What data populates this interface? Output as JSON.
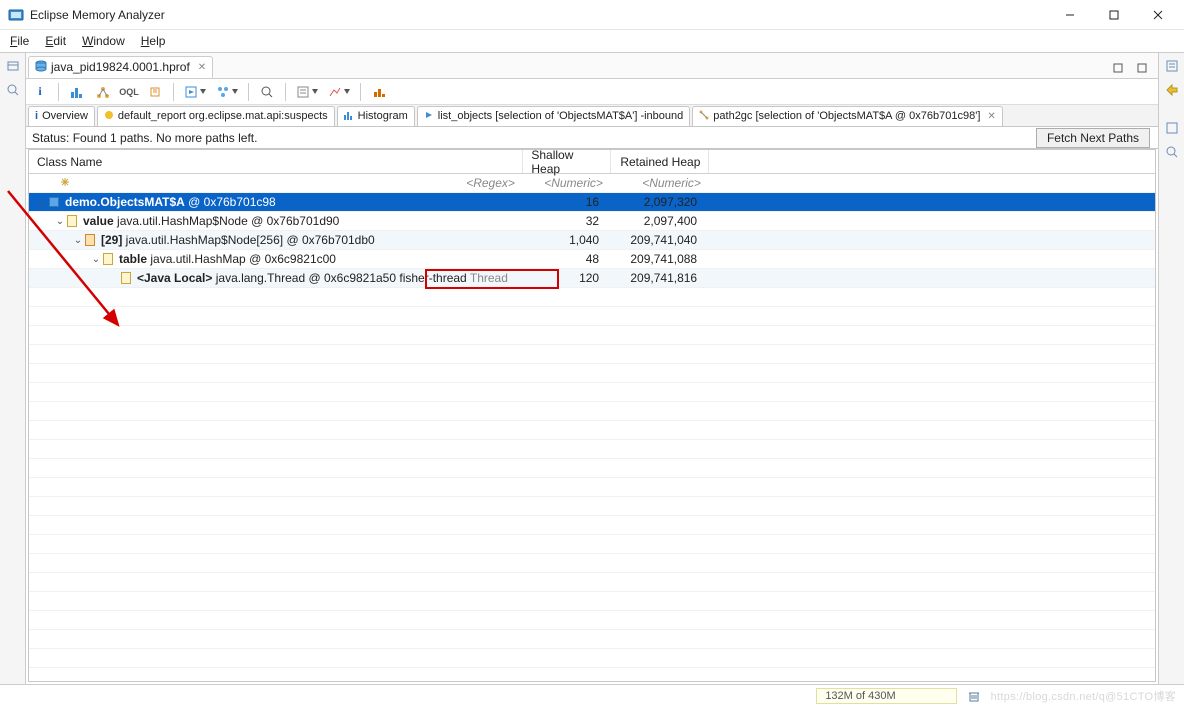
{
  "title": "Eclipse Memory Analyzer",
  "menus": {
    "file": "File",
    "edit": "Edit",
    "window": "Window",
    "help": "Help"
  },
  "editorTab": {
    "label": "java_pid19824.0001.hprof"
  },
  "subtabs": {
    "overview": "Overview",
    "report": "default_report  org.eclipse.mat.api:suspects",
    "histogram": "Histogram",
    "listobj": "list_objects [selection of 'ObjectsMAT$A'] -inbound",
    "path2gc": "path2gc [selection of 'ObjectsMAT$A @ 0x76b701c98']"
  },
  "status": "Status:  Found 1 paths. No more paths left.",
  "fetch": "Fetch Next Paths",
  "columns": {
    "name": "Class Name",
    "shallow": "Shallow Heap",
    "retained": "Retained Heap"
  },
  "regexRow": {
    "placeholder": "<Regex>",
    "num": "<Numeric>"
  },
  "rows": [
    {
      "indent": 0,
      "expander": "v",
      "iconClass": "blue-sq",
      "prefix": "",
      "bold": "demo.ObjectsMAT$A",
      "suffix": " @ 0x76b701c98",
      "shallow": "16",
      "retained": "2,097,320",
      "sel": true
    },
    {
      "indent": 1,
      "expander": "v",
      "iconClass": "yellow-doc",
      "prefix": "",
      "bold": "value",
      "suffix": " java.util.HashMap$Node @ 0x76b701d90",
      "shallow": "32",
      "retained": "2,097,400",
      "alt": false
    },
    {
      "indent": 2,
      "expander": "v",
      "iconClass": "orange-doc",
      "prefix": "",
      "bold": "[29]",
      "suffix": " java.util.HashMap$Node[256] @ 0x76b701db0",
      "shallow": "1,040",
      "retained": "209,741,040",
      "alt": true
    },
    {
      "indent": 3,
      "expander": "v",
      "iconClass": "yellow-doc",
      "prefix": "",
      "bold": "table",
      "suffix": " java.util.HashMap @ 0x6c9821c00",
      "shallow": "48",
      "retained": "209,741,088",
      "alt": false
    },
    {
      "indent": 4,
      "expander": "",
      "iconClass": "yellow-doc",
      "prefix": "",
      "bold": "<Java Local>",
      "suffix": " java.lang.Thread @ 0x6c9821a50",
      "tail": "  fisher-thread ",
      "tailGrey": "Thread",
      "shallow": "120",
      "retained": "209,741,816",
      "alt": true
    }
  ],
  "heap": "132M of 430M",
  "watermark": "https://blog.csdn.net/q@51CTO博客"
}
